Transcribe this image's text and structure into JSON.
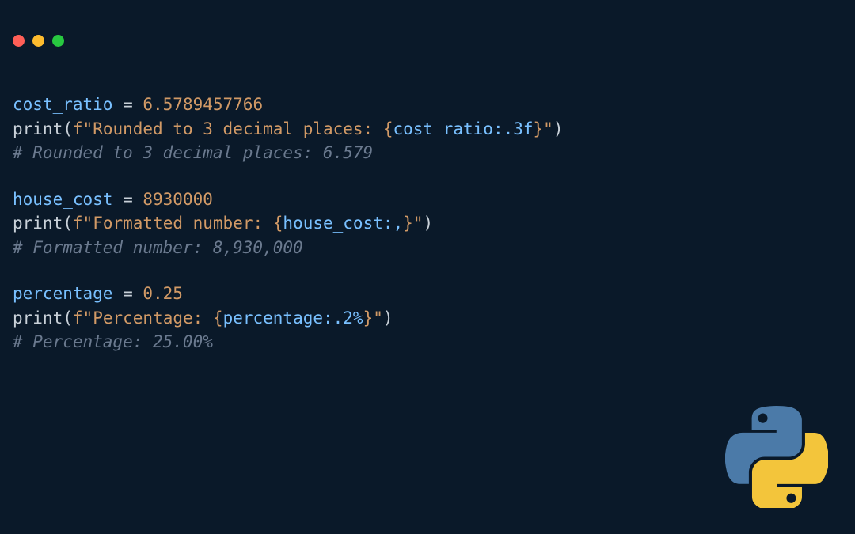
{
  "block1": {
    "var": "cost_ratio",
    "eq": " = ",
    "val": "6.5789457766",
    "print_fn": "print",
    "open_paren": "(",
    "fprefix": "f",
    "quote_open": "\"",
    "str_a": "Rounded to 3 decimal places: ",
    "brace_open": "{",
    "expr_var": "cost_ratio",
    "fmt": ":.3f",
    "brace_close": "}",
    "quote_close": "\"",
    "close_paren": ")",
    "comment": "# Rounded to 3 decimal places: 6.579"
  },
  "block2": {
    "var": "house_cost",
    "eq": " = ",
    "val": "8930000",
    "print_fn": "print",
    "open_paren": "(",
    "fprefix": "f",
    "quote_open": "\"",
    "str_a": "Formatted number: ",
    "brace_open": "{",
    "expr_var": "house_cost",
    "fmt": ":,",
    "brace_close": "}",
    "quote_close": "\"",
    "close_paren": ")",
    "comment": "# Formatted number: 8,930,000"
  },
  "block3": {
    "var": "percentage",
    "eq": " = ",
    "val": "0.25",
    "print_fn": "print",
    "open_paren": "(",
    "fprefix": "f",
    "quote_open": "\"",
    "str_a": "Percentage: ",
    "brace_open": "{",
    "expr_var": "percentage",
    "fmt": ":.2%",
    "brace_close": "}",
    "quote_close": "\"",
    "close_paren": ")",
    "comment": "# Percentage: 25.00%"
  }
}
